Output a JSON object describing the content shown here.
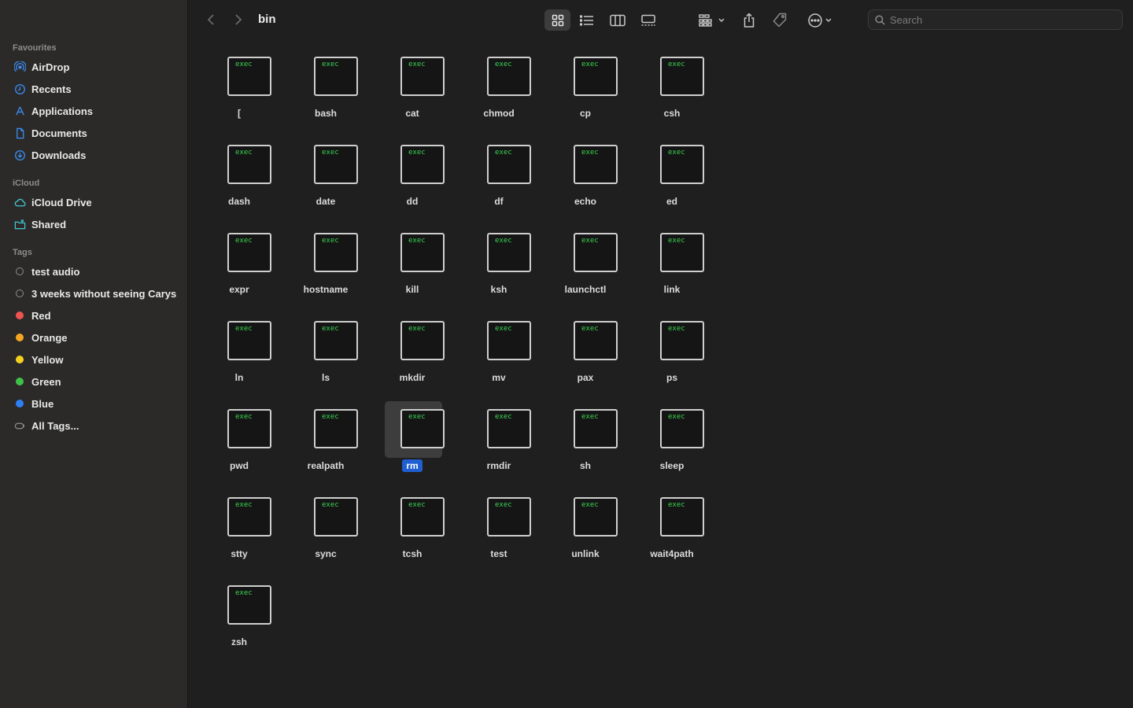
{
  "window": {
    "title": "bin"
  },
  "sidebar": {
    "favourites_label": "Favourites",
    "favourites": [
      {
        "label": "AirDrop",
        "icon": "airdrop-icon"
      },
      {
        "label": "Recents",
        "icon": "clock-icon"
      },
      {
        "label": "Applications",
        "icon": "applications-icon"
      },
      {
        "label": "Documents",
        "icon": "document-icon"
      },
      {
        "label": "Downloads",
        "icon": "download-icon"
      }
    ],
    "icloud_label": "iCloud",
    "icloud": [
      {
        "label": "iCloud Drive",
        "icon": "cloud-icon"
      },
      {
        "label": "Shared",
        "icon": "shared-folder-icon"
      }
    ],
    "tags_label": "Tags",
    "tags": [
      {
        "label": "test audio",
        "color": ""
      },
      {
        "label": "3 weeks without seeing Carys",
        "color": ""
      },
      {
        "label": "Red",
        "color": "#ef5350"
      },
      {
        "label": "Orange",
        "color": "#f5a623"
      },
      {
        "label": "Yellow",
        "color": "#f3d21f"
      },
      {
        "label": "Green",
        "color": "#3fc148"
      },
      {
        "label": "Blue",
        "color": "#2f7ff5"
      },
      {
        "label": "All Tags...",
        "color": ""
      }
    ]
  },
  "toolbar": {
    "search_placeholder": "Search",
    "active_view": "icon-view"
  },
  "files": {
    "badge": "exec",
    "selected": "rm",
    "items": [
      "[",
      "bash",
      "cat",
      "chmod",
      "cp",
      "csh",
      "dash",
      "date",
      "dd",
      "df",
      "echo",
      "ed",
      "expr",
      "hostname",
      "kill",
      "ksh",
      "launchctl",
      "link",
      "ln",
      "ls",
      "mkdir",
      "mv",
      "pax",
      "ps",
      "pwd",
      "realpath",
      "rm",
      "rmdir",
      "sh",
      "sleep",
      "stty",
      "sync",
      "tcsh",
      "test",
      "unlink",
      "wait4path",
      "zsh"
    ]
  },
  "colors": {
    "accent": "#1f5fd1",
    "exec_text": "#39d353"
  }
}
